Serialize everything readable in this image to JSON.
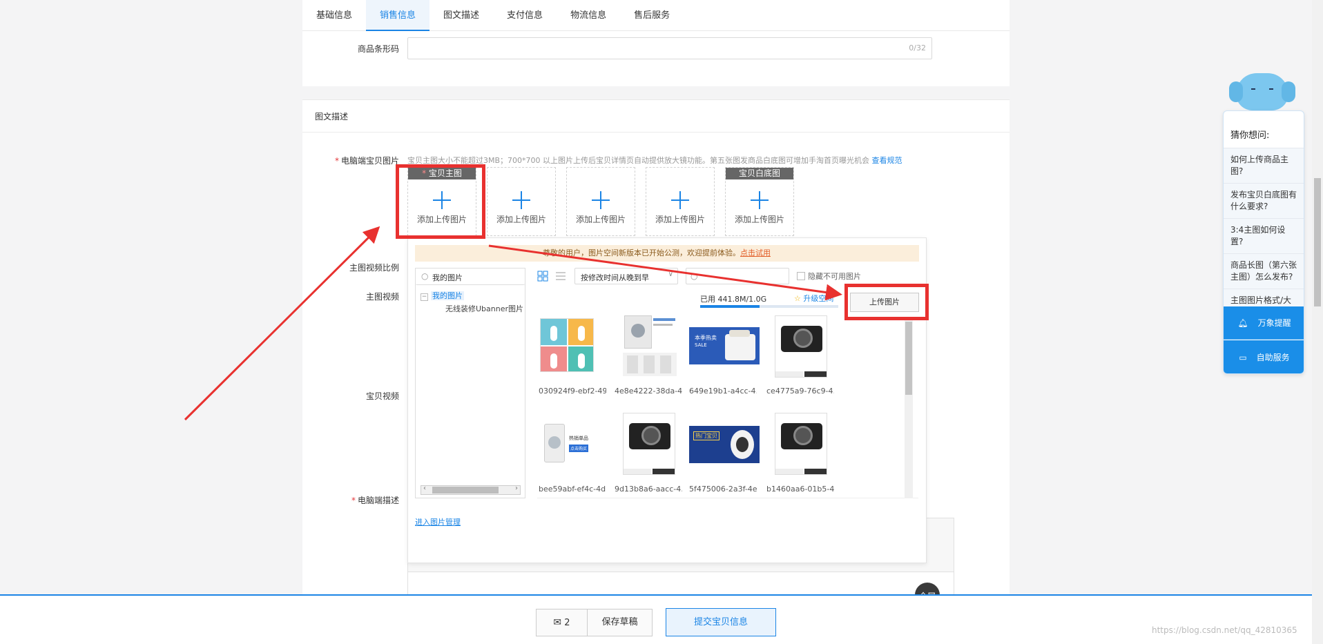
{
  "tabs": [
    "基础信息",
    "销售信息",
    "图文描述",
    "支付信息",
    "物流信息",
    "售后服务"
  ],
  "barcode": {
    "label": "商品条形码",
    "counter": "0/32"
  },
  "section_title": "图文描述",
  "pc_images": {
    "label": "电脑端宝贝图片",
    "hint": "宝贝主图大小不能超过3MB；700*700 以上图片上传后宝贝详情页自动提供放大镜功能。第五张图发商品白底图可增加手淘首页曝光机会",
    "hint_link": "查看规范",
    "slot_main_tag": "宝贝主图",
    "slot_white_tag": "宝贝白底图",
    "slot_text": "添加上传图片"
  },
  "left_labels": {
    "ratio": "主图视频比例",
    "video": "主图视频",
    "item_video": "宝贝视频",
    "pc_desc": "电脑端描述"
  },
  "picker": {
    "notice": "尊敬的用户，图片空间新版本已开始公测，欢迎提前体验。",
    "notice_link": "点击试用",
    "search_placeholder": "我的图片",
    "tree_root": "我的图片",
    "tree_child": "无线装修Ubanner图片",
    "sort": "按修改时间从晚到早",
    "hide_unavailable": "隐藏不可用图片",
    "usage": "已用 441.8M/1.0G",
    "usage_fraction": 0.43,
    "upgrade": "升级空间",
    "upload_button": "上传图片",
    "manage_link": "进入图片管理",
    "images": [
      "030924f9-ebf2-49…",
      "4e8e4222-38da-4…",
      "649e19b1-a4cc-4…",
      "ce4775a9-76c9-4…",
      "bee59abf-ef4c-4d…",
      "9d13b8a6-aacc-4…",
      "5f475006-2a3f-4e…",
      "b1460aa6-01b5-4…"
    ],
    "thumb_texts": {
      "banner1_line1": "本季热卖",
      "banner1_line2": "SALE",
      "banner2_line1": "热门宝贝",
      "washer_line1": "热销单品",
      "washer_line2": "点击购买"
    }
  },
  "sidebar": {
    "title": "猜你想问:",
    "questions": [
      "如何上传商品主图?",
      "发布宝贝白底图有什么要求?",
      "3:4主图如何设置?",
      "商品长图（第六张主图）怎么发布?",
      "主图图片格式/大小要求是什么?"
    ],
    "remind": "万象提醒",
    "self_service": "自助服务"
  },
  "fullscreen": "全屏",
  "footer": {
    "msg_count": "2",
    "save_draft": "保存草稿",
    "submit": "提交宝贝信息"
  },
  "watermark": "https://blog.csdn.net/qq_42810365",
  "colors": {
    "accent": "#1a84e5",
    "annotation_red": "#e8312f",
    "notice_bg": "#fbeedb"
  }
}
